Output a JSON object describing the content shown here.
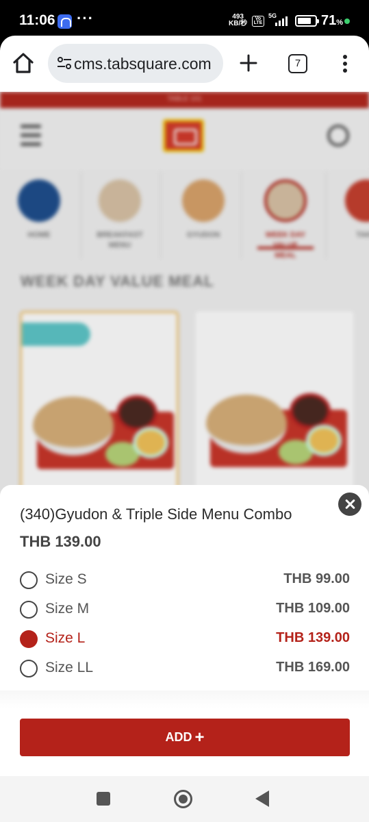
{
  "status_bar": {
    "time": "11:06",
    "more": "···",
    "net_speed_value": "493",
    "net_speed_unit": "KB/秒",
    "volte": "Vo LTE",
    "network": "5G",
    "battery_pct": "71",
    "battery_unit": "%"
  },
  "browser": {
    "url": "cms.tabsquare.com",
    "tab_count": "7"
  },
  "page": {
    "banner": "TABLE 101",
    "categories": [
      {
        "label": "HOME"
      },
      {
        "label": "BREAKFAST MENU"
      },
      {
        "label": "GYUDON"
      },
      {
        "label": "WEEK DAY VALUE MEAL"
      },
      {
        "label": "TAKE"
      }
    ],
    "section_title": "WEEK DAY VALUE MEAL"
  },
  "sheet": {
    "title": "(340)Gyudon & Triple Side Menu Combo",
    "price": "THB 139.00",
    "options": [
      {
        "label": "Size S",
        "price": "THB 99.00",
        "selected": false
      },
      {
        "label": "Size M",
        "price": "THB 109.00",
        "selected": false
      },
      {
        "label": "Size L",
        "price": "THB 139.00",
        "selected": true
      },
      {
        "label": "Size LL",
        "price": "THB 169.00",
        "selected": false
      }
    ],
    "add_label": "ADD",
    "add_icon": "+"
  },
  "colors": {
    "accent": "#b4221a",
    "banner": "#b4291f"
  }
}
